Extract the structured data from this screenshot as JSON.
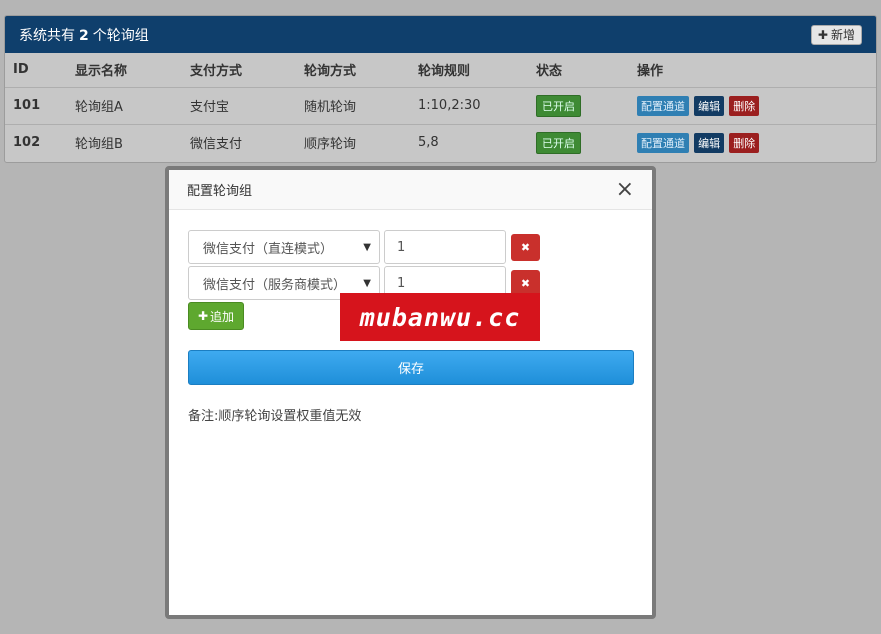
{
  "header": {
    "prefix": "系统共有",
    "count": "2",
    "suffix": "个轮询组",
    "add_label": "新增",
    "add_icon": "plus-icon"
  },
  "table": {
    "columns": [
      "ID",
      "显示名称",
      "支付方式",
      "轮询方式",
      "轮询规则",
      "状态",
      "操作"
    ],
    "rows": [
      {
        "id": "101",
        "name": "轮询组A",
        "pay": "支付宝",
        "mode": "随机轮询",
        "rule": "1:10,2:30",
        "status": "已开启"
      },
      {
        "id": "102",
        "name": "轮询组B",
        "pay": "微信支付",
        "mode": "顺序轮询",
        "rule": "5,8",
        "status": "已开启"
      }
    ],
    "actions": {
      "config": "配置通道",
      "edit": "编辑",
      "delete": "删除"
    }
  },
  "modal": {
    "title": "配置轮询组",
    "close": "×",
    "channels": [
      {
        "channel": "微信支付（直连模式）",
        "weight": "1"
      },
      {
        "channel": "微信支付（服务商模式）",
        "weight": "1"
      }
    ],
    "append_label": "追加",
    "save_label": "保存",
    "note": "备注:顺序轮询设置权重值无效"
  },
  "watermark": "mubanwu.cc",
  "colors": {
    "header_bg": "#0f3f6c",
    "status_on": "#3e8a34",
    "config_btn": "#2f7fb3",
    "edit_btn": "#123b63",
    "delete_btn": "#9b1f1f",
    "save_btn": "#2a9be4",
    "append_btn": "#5ea82f",
    "watermark_bg": "#d6141c"
  }
}
